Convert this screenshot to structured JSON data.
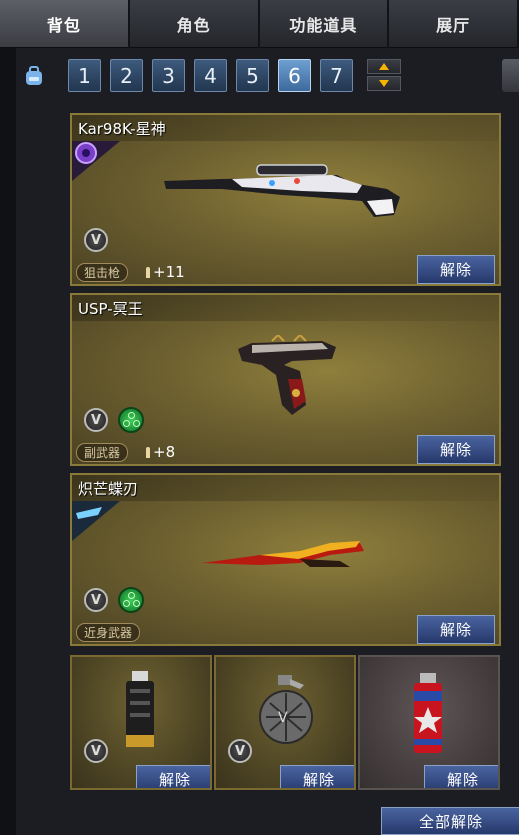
{
  "tabs": [
    {
      "label": "背包",
      "active": true
    },
    {
      "label": "角色",
      "active": false
    },
    {
      "label": "功能道具",
      "active": false
    },
    {
      "label": "展厅",
      "active": false
    }
  ],
  "pagination": {
    "pages": [
      "1",
      "2",
      "3",
      "4",
      "5",
      "6",
      "7"
    ],
    "current_page": "6"
  },
  "items": [
    {
      "name": "Kar98K-星神",
      "type": "狙击枪",
      "ammo": "+11",
      "unequip_label": "解除",
      "badges": [
        "v-icon"
      ],
      "corner_icon": "purple-emblem"
    },
    {
      "name": "USP-冥王",
      "type": "副武器",
      "ammo": "+8",
      "unequip_label": "解除",
      "badges": [
        "v-icon",
        "green-icon"
      ]
    },
    {
      "name": "炽芒蝶刃",
      "type": "近身武器",
      "ammo": "",
      "unequip_label": "解除",
      "badges": [
        "v-icon",
        "green-icon"
      ],
      "corner_icon": "blue-emblem"
    }
  ],
  "throwables": [
    {
      "icon": "flashbang-grenade-icon",
      "unequip_label": "解除",
      "has_v_badge": true
    },
    {
      "icon": "frag-grenade-icon",
      "unequip_label": "解除",
      "has_v_badge": true
    },
    {
      "icon": "smoke-grenade-icon",
      "unequip_label": "解除",
      "has_v_badge": false
    }
  ],
  "unequip_all_label": "全部解除",
  "colors": {
    "accent_gold": "#8a7a3a",
    "button_blue": "#3a5290",
    "active_page": "#5a8ac0"
  }
}
